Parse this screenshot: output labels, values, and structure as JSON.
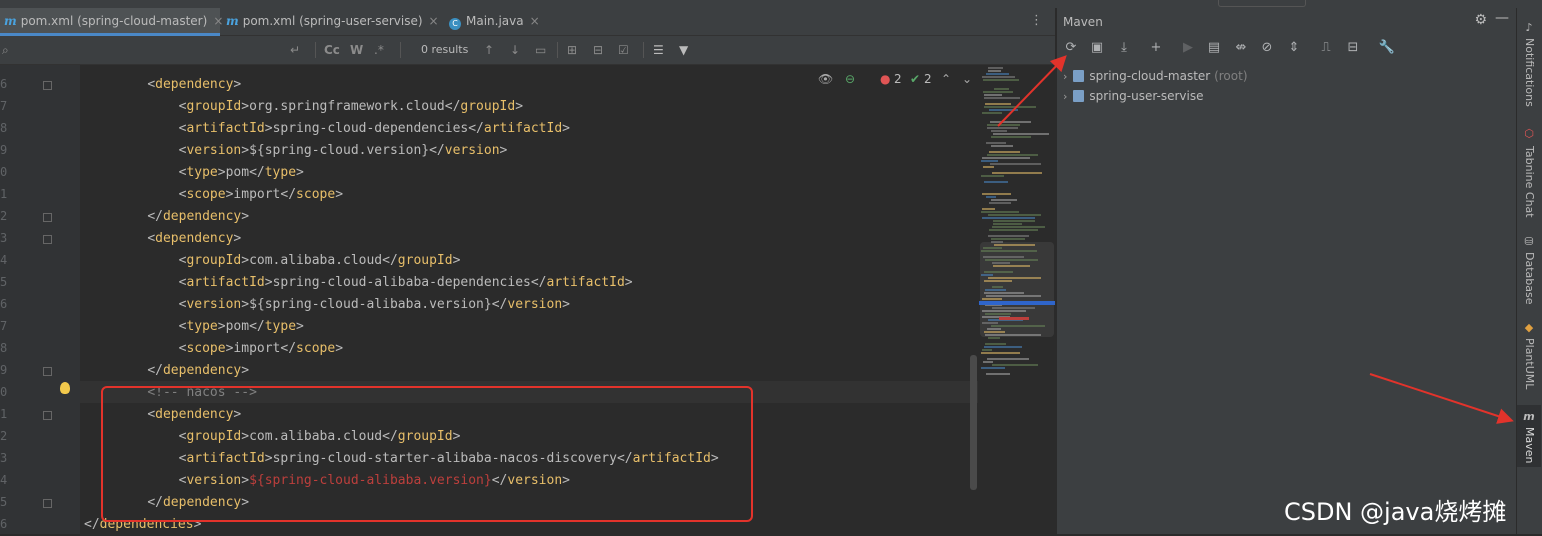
{
  "editor_tabs": [
    {
      "icon": "maven-icon",
      "label": "pom.xml (spring-cloud-master)",
      "active": true
    },
    {
      "icon": "maven-icon",
      "label": "pom.xml (spring-user-servise)",
      "active": false
    },
    {
      "icon": "java-class-icon",
      "label": "Main.java",
      "active": false
    }
  ],
  "find_bar": {
    "search_value": "",
    "results_text": "0 results",
    "opt_case": "Cc",
    "opt_words": "W"
  },
  "inspections": {
    "errors": "2",
    "warnings": "2"
  },
  "gutter": {
    "line_numbers": [
      "6",
      "7",
      "8",
      "9",
      "0",
      "1",
      "2",
      "3",
      "4",
      "5",
      "6",
      "7",
      "8",
      "9",
      "0",
      "1",
      "2",
      "3",
      "4",
      "5",
      "6"
    ]
  },
  "code": {
    "lines": [
      {
        "indent": "    ",
        "parts": [
          {
            "t": "<",
            "c": "br"
          },
          {
            "t": "dependency",
            "c": "tagc"
          },
          {
            "t": ">",
            "c": "br"
          }
        ]
      },
      {
        "indent": "        ",
        "parts": [
          {
            "t": "<",
            "c": "br"
          },
          {
            "t": "groupId",
            "c": "tagc"
          },
          {
            "t": ">",
            "c": "br"
          },
          {
            "t": "org.springframework.cloud",
            "c": "br"
          },
          {
            "t": "</",
            "c": "br"
          },
          {
            "t": "groupId",
            "c": "tagc"
          },
          {
            "t": ">",
            "c": "br"
          }
        ]
      },
      {
        "indent": "        ",
        "parts": [
          {
            "t": "<",
            "c": "br"
          },
          {
            "t": "artifactId",
            "c": "tagc"
          },
          {
            "t": ">",
            "c": "br"
          },
          {
            "t": "spring-cloud-dependencies",
            "c": "br"
          },
          {
            "t": "</",
            "c": "br"
          },
          {
            "t": "artifactId",
            "c": "tagc"
          },
          {
            "t": ">",
            "c": "br"
          }
        ]
      },
      {
        "indent": "        ",
        "parts": [
          {
            "t": "<",
            "c": "br"
          },
          {
            "t": "version",
            "c": "tagc"
          },
          {
            "t": ">",
            "c": "br"
          },
          {
            "t": "${spring-cloud.version}",
            "c": "br"
          },
          {
            "t": "</",
            "c": "br"
          },
          {
            "t": "version",
            "c": "tagc"
          },
          {
            "t": ">",
            "c": "br"
          }
        ]
      },
      {
        "indent": "        ",
        "parts": [
          {
            "t": "<",
            "c": "br"
          },
          {
            "t": "type",
            "c": "tagc"
          },
          {
            "t": ">",
            "c": "br"
          },
          {
            "t": "pom",
            "c": "br"
          },
          {
            "t": "</",
            "c": "br"
          },
          {
            "t": "type",
            "c": "tagc"
          },
          {
            "t": ">",
            "c": "br"
          }
        ]
      },
      {
        "indent": "        ",
        "parts": [
          {
            "t": "<",
            "c": "br"
          },
          {
            "t": "scope",
            "c": "tagc"
          },
          {
            "t": ">",
            "c": "br"
          },
          {
            "t": "import",
            "c": "br"
          },
          {
            "t": "</",
            "c": "br"
          },
          {
            "t": "scope",
            "c": "tagc"
          },
          {
            "t": ">",
            "c": "br"
          }
        ]
      },
      {
        "indent": "    ",
        "parts": [
          {
            "t": "</",
            "c": "br"
          },
          {
            "t": "dependency",
            "c": "tagc"
          },
          {
            "t": ">",
            "c": "br"
          }
        ]
      },
      {
        "indent": "    ",
        "parts": [
          {
            "t": "<",
            "c": "br"
          },
          {
            "t": "dependency",
            "c": "tagc"
          },
          {
            "t": ">",
            "c": "br"
          }
        ]
      },
      {
        "indent": "        ",
        "parts": [
          {
            "t": "<",
            "c": "br"
          },
          {
            "t": "groupId",
            "c": "tagc"
          },
          {
            "t": ">",
            "c": "br"
          },
          {
            "t": "com.alibaba.cloud",
            "c": "br"
          },
          {
            "t": "</",
            "c": "br"
          },
          {
            "t": "groupId",
            "c": "tagc"
          },
          {
            "t": ">",
            "c": "br"
          }
        ]
      },
      {
        "indent": "        ",
        "parts": [
          {
            "t": "<",
            "c": "br"
          },
          {
            "t": "artifactId",
            "c": "tagc"
          },
          {
            "t": ">",
            "c": "br"
          },
          {
            "t": "spring-cloud-alibaba-dependencies",
            "c": "br"
          },
          {
            "t": "</",
            "c": "br"
          },
          {
            "t": "artifactId",
            "c": "tagc"
          },
          {
            "t": ">",
            "c": "br"
          }
        ]
      },
      {
        "indent": "        ",
        "parts": [
          {
            "t": "<",
            "c": "br"
          },
          {
            "t": "version",
            "c": "tagc"
          },
          {
            "t": ">",
            "c": "br"
          },
          {
            "t": "${spring-cloud-alibaba.version}",
            "c": "br"
          },
          {
            "t": "</",
            "c": "br"
          },
          {
            "t": "version",
            "c": "tagc"
          },
          {
            "t": ">",
            "c": "br"
          }
        ]
      },
      {
        "indent": "        ",
        "parts": [
          {
            "t": "<",
            "c": "br"
          },
          {
            "t": "type",
            "c": "tagc"
          },
          {
            "t": ">",
            "c": "br"
          },
          {
            "t": "pom",
            "c": "br"
          },
          {
            "t": "</",
            "c": "br"
          },
          {
            "t": "type",
            "c": "tagc"
          },
          {
            "t": ">",
            "c": "br"
          }
        ]
      },
      {
        "indent": "        ",
        "parts": [
          {
            "t": "<",
            "c": "br"
          },
          {
            "t": "scope",
            "c": "tagc"
          },
          {
            "t": ">",
            "c": "br"
          },
          {
            "t": "import",
            "c": "br"
          },
          {
            "t": "</",
            "c": "br"
          },
          {
            "t": "scope",
            "c": "tagc"
          },
          {
            "t": ">",
            "c": "br"
          }
        ]
      },
      {
        "indent": "    ",
        "parts": [
          {
            "t": "</",
            "c": "br"
          },
          {
            "t": "dependency",
            "c": "tagc"
          },
          {
            "t": ">",
            "c": "br"
          }
        ]
      },
      {
        "indent": "    ",
        "parts": [
          {
            "t": "<!-- ",
            "c": "cmt"
          },
          {
            "t": "nacos",
            "c": "cmt u"
          },
          {
            "t": " -->",
            "c": "cmt"
          }
        ]
      },
      {
        "indent": "    ",
        "parts": [
          {
            "t": "<",
            "c": "br"
          },
          {
            "t": "dependency",
            "c": "tagc"
          },
          {
            "t": ">",
            "c": "br"
          }
        ]
      },
      {
        "indent": "        ",
        "parts": [
          {
            "t": "<",
            "c": "br"
          },
          {
            "t": "groupId",
            "c": "tagc"
          },
          {
            "t": ">",
            "c": "br"
          },
          {
            "t": "com.alibaba.cloud",
            "c": "br"
          },
          {
            "t": "</",
            "c": "br"
          },
          {
            "t": "groupId",
            "c": "tagc"
          },
          {
            "t": ">",
            "c": "br"
          }
        ]
      },
      {
        "indent": "        ",
        "parts": [
          {
            "t": "<",
            "c": "br"
          },
          {
            "t": "artifactId",
            "c": "tagc"
          },
          {
            "t": ">",
            "c": "br"
          },
          {
            "t": "spring-cloud-starter-alibaba-nacos-discovery",
            "c": "br"
          },
          {
            "t": "</",
            "c": "br"
          },
          {
            "t": "artifactId",
            "c": "tagc"
          },
          {
            "t": ">",
            "c": "br"
          }
        ]
      },
      {
        "indent": "        ",
        "parts": [
          {
            "t": "<",
            "c": "br"
          },
          {
            "t": "version",
            "c": "tagc"
          },
          {
            "t": ">",
            "c": "br"
          },
          {
            "t": "${spring-cloud-alibaba.version}",
            "c": "err"
          },
          {
            "t": "</",
            "c": "br"
          },
          {
            "t": "version",
            "c": "tagc"
          },
          {
            "t": ">",
            "c": "br"
          }
        ]
      },
      {
        "indent": "    ",
        "parts": [
          {
            "t": "</",
            "c": "br"
          },
          {
            "t": "dependency",
            "c": "tagc"
          },
          {
            "t": ">",
            "c": "br"
          }
        ]
      },
      {
        "indent": "",
        "parts": [
          {
            "t": "</",
            "c": "br"
          },
          {
            "t": "dependencies",
            "c": "tagc"
          },
          {
            "t": ">",
            "c": "br"
          }
        ]
      }
    ]
  },
  "maven_panel": {
    "title": "Maven",
    "projects": [
      {
        "name": "spring-cloud-master",
        "suffix": "(root)"
      },
      {
        "name": "spring-user-servise",
        "suffix": ""
      }
    ]
  },
  "right_strip": {
    "tabs": [
      "Notifications",
      "Tabnine Chat",
      "Database",
      "PlantUML",
      "Maven"
    ]
  },
  "watermark": "CSDN @java烧烤摊",
  "colors": {
    "editor_bg": "#2b2b2b",
    "panel_bg": "#3c3f41",
    "tag": "#e8bf6a",
    "error": "#bc3f3c",
    "highlight_box": "#e2332b",
    "accent": "#4a88c7"
  }
}
